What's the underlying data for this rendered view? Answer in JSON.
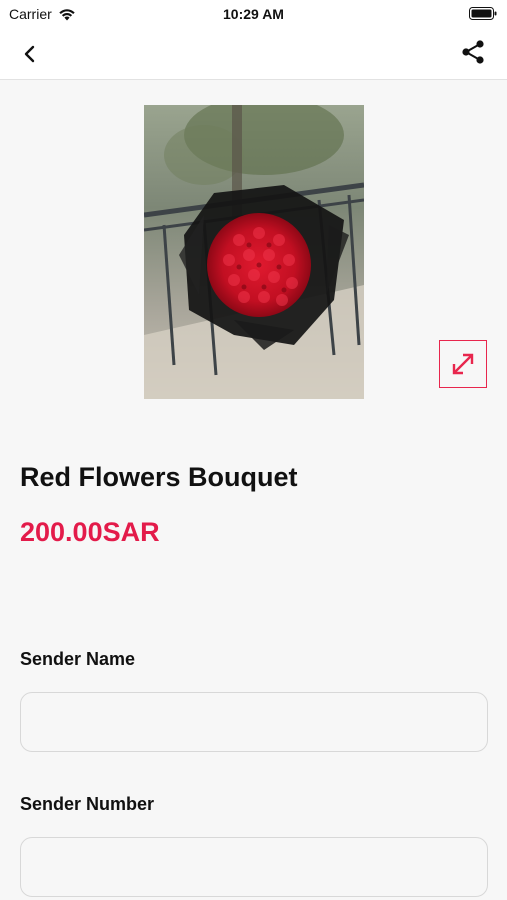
{
  "status_bar": {
    "carrier": "Carrier",
    "time": "10:29 AM"
  },
  "nav": {
    "back_icon": "chevron-left-icon",
    "share_icon": "share-icon"
  },
  "product": {
    "name": "Red Flowers Bouquet",
    "price": "200.00SAR",
    "expand_icon": "expand-icon",
    "accent_color": "#e31b4a"
  },
  "form": {
    "sender_name": {
      "label": "Sender Name",
      "value": "",
      "placeholder": ""
    },
    "sender_number": {
      "label": "Sender Number",
      "value": "",
      "placeholder": ""
    }
  }
}
